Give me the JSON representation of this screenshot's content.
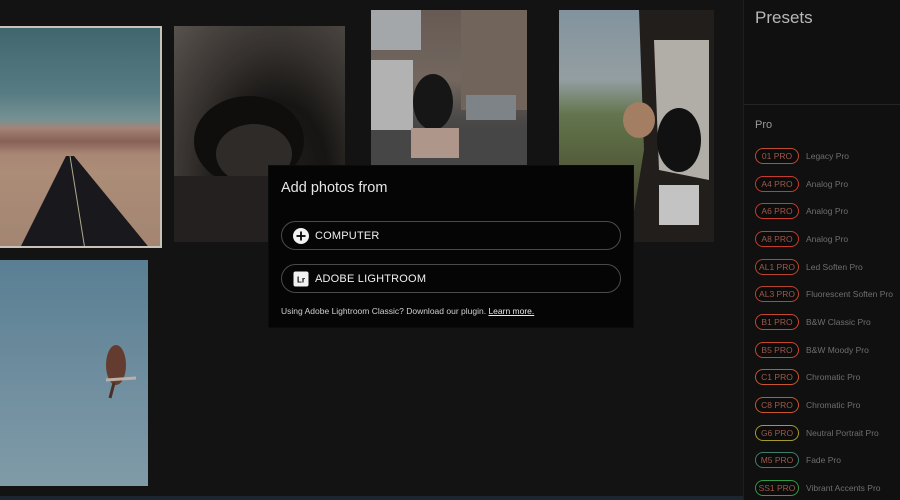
{
  "sidebar": {
    "title": "Presets",
    "section_title": "Pro",
    "presets": [
      {
        "code": "01 PRO",
        "name": "Legacy Pro",
        "color": "#c04a32"
      },
      {
        "code": "A4 PRO",
        "name": "Analog Pro",
        "color": "#c73b2c"
      },
      {
        "code": "A6 PRO",
        "name": "Analog Pro",
        "color": "#c73b2c"
      },
      {
        "code": "A8 PRO",
        "name": "Analog Pro",
        "color": "#c73b2c"
      },
      {
        "code": "AL1 PRO",
        "name": "Led Soften Pro",
        "color": "#b9452e"
      },
      {
        "code": "AL3 PRO",
        "name": "Fluorescent Soften Pro",
        "color": "#b9452e"
      },
      {
        "code": "B1 PRO",
        "name": "B&W Classic Pro",
        "color": "#c8452d"
      },
      {
        "code": "B5 PRO",
        "name": "B&W Moody Pro",
        "color": "#c8452d"
      },
      {
        "code": "C1 PRO",
        "name": "Chromatic Pro",
        "color": "#c9552c"
      },
      {
        "code": "C8 PRO",
        "name": "Chromatic Pro",
        "color": "#c9552c"
      },
      {
        "code": "G6 PRO",
        "name": "Neutral Portrait Pro",
        "color": "#a59b2c"
      },
      {
        "code": "M5 PRO",
        "name": "Fade Pro",
        "color": "#3f7f6a"
      },
      {
        "code": "SS1 PRO",
        "name": "Vibrant Accents Pro",
        "color": "#2f9b43"
      }
    ]
  },
  "modal": {
    "title": "Add photos from",
    "computer_label": "COMPUTER",
    "lightroom_label": "ADOBE LIGHTROOM",
    "lightroom_icon_text": "Lr",
    "note_text": "Using Adobe Lightroom Classic? Download our plugin.",
    "learn_more": "Learn more."
  }
}
